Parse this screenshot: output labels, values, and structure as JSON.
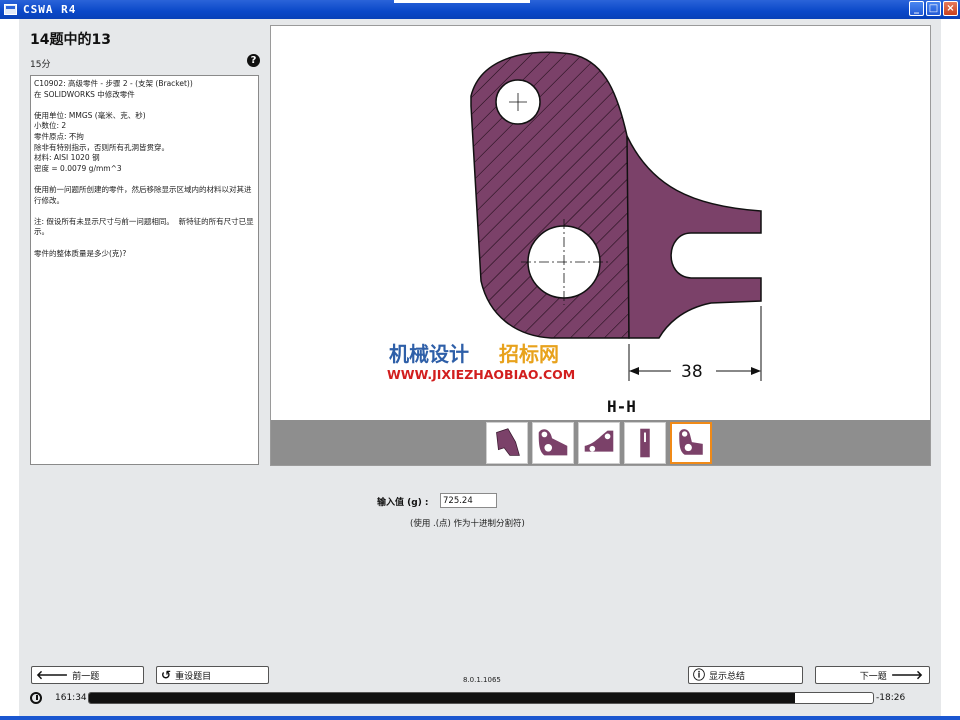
{
  "window": {
    "title": "CSWA R4",
    "buttons": {
      "minimize": "_",
      "maximize": "□",
      "close": "×"
    }
  },
  "question": {
    "heading": "14题中的13",
    "points": "15分",
    "text": "C10902: 高级零件 - 步骤 2 - (支架 (Bracket))\n在 SOLIDWORKS 中修改零件\n\n使用单位: MMGS (毫米、克、秒)\n小数位: 2\n零件原点: 不拘\n除非有特别指示，否则所有孔洞皆贯穿。\n材料: AISI 1020 钢\n密度 = 0.0079 g/mm^3\n\n使用前一问题所创建的零件，然后移除显示区域内的材料以对其进行修改。\n\n注: 假设所有未显示尺寸与前一问题相同。  新特征的所有尺寸已显示。\n\n零件的整体质量是多少(克)?"
  },
  "drawing": {
    "dimension": "38",
    "section_label": "H-H",
    "watermark_line1": "机械设计",
    "watermark_line2": "招标网",
    "watermark_url": "WWW.JIXIEZHAOBIAO.COM",
    "part_color": "#7b4169",
    "thumbnails": [
      {
        "name": "thumb-1",
        "active": false
      },
      {
        "name": "thumb-2",
        "active": false
      },
      {
        "name": "thumb-3",
        "active": false
      },
      {
        "name": "thumb-4",
        "active": false
      },
      {
        "name": "thumb-5",
        "active": true
      }
    ]
  },
  "answer": {
    "label": "输入值 (g) :",
    "value": "725.24",
    "hint": "(使用 .(点) 作为十进制分割符)"
  },
  "footer": {
    "prev_label": "前一题",
    "reset_label": "重设题目",
    "version": "8.0.1.1065",
    "summary_label": "显示总结",
    "next_label": "下一题",
    "elapsed": "161:34",
    "remaining": "-18:26",
    "progress_fraction": 0.9
  },
  "icons": {
    "prev": "arrow-left-icon",
    "reset": "rotate-left-icon",
    "summary": "info-icon",
    "next": "arrow-right-icon",
    "help": "question-icon",
    "timer": "clock-icon"
  }
}
